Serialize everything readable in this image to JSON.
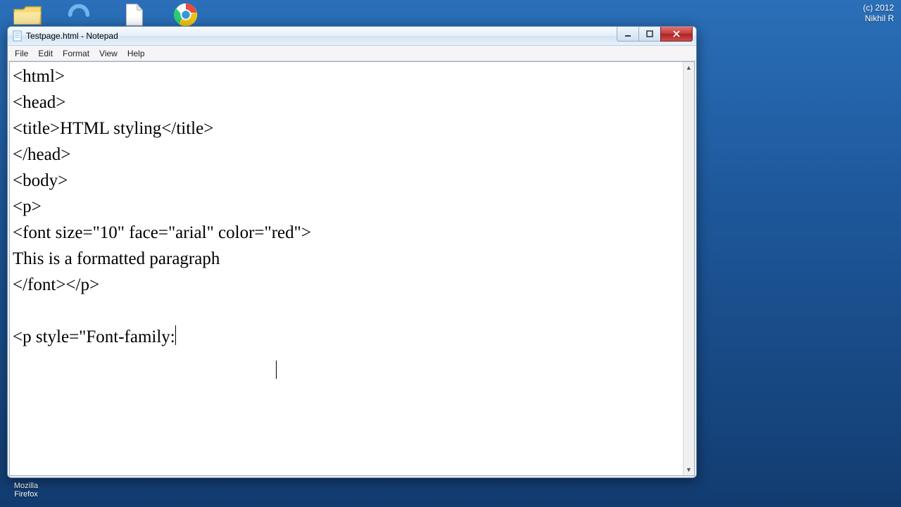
{
  "watermark": {
    "line1": "(c) 2012",
    "line2": "Nikhil R"
  },
  "desktop_icons": {
    "firefox_label_1": "Mozilla",
    "firefox_label_2": "Firefox"
  },
  "window": {
    "title": "Testpage.html - Notepad",
    "menus": {
      "file": "File",
      "edit": "Edit",
      "format": "Format",
      "view": "View",
      "help": "Help"
    },
    "editor_lines": [
      "<html>",
      "<head>",
      "<title>HTML styling</title>",
      "</head>",
      "<body>",
      "<p>",
      "<font size=\"10\" face=\"arial\" color=\"red\">",
      "This is a formatted paragraph",
      "</font></p>",
      "",
      "<p style=\"Font-family:"
    ]
  }
}
